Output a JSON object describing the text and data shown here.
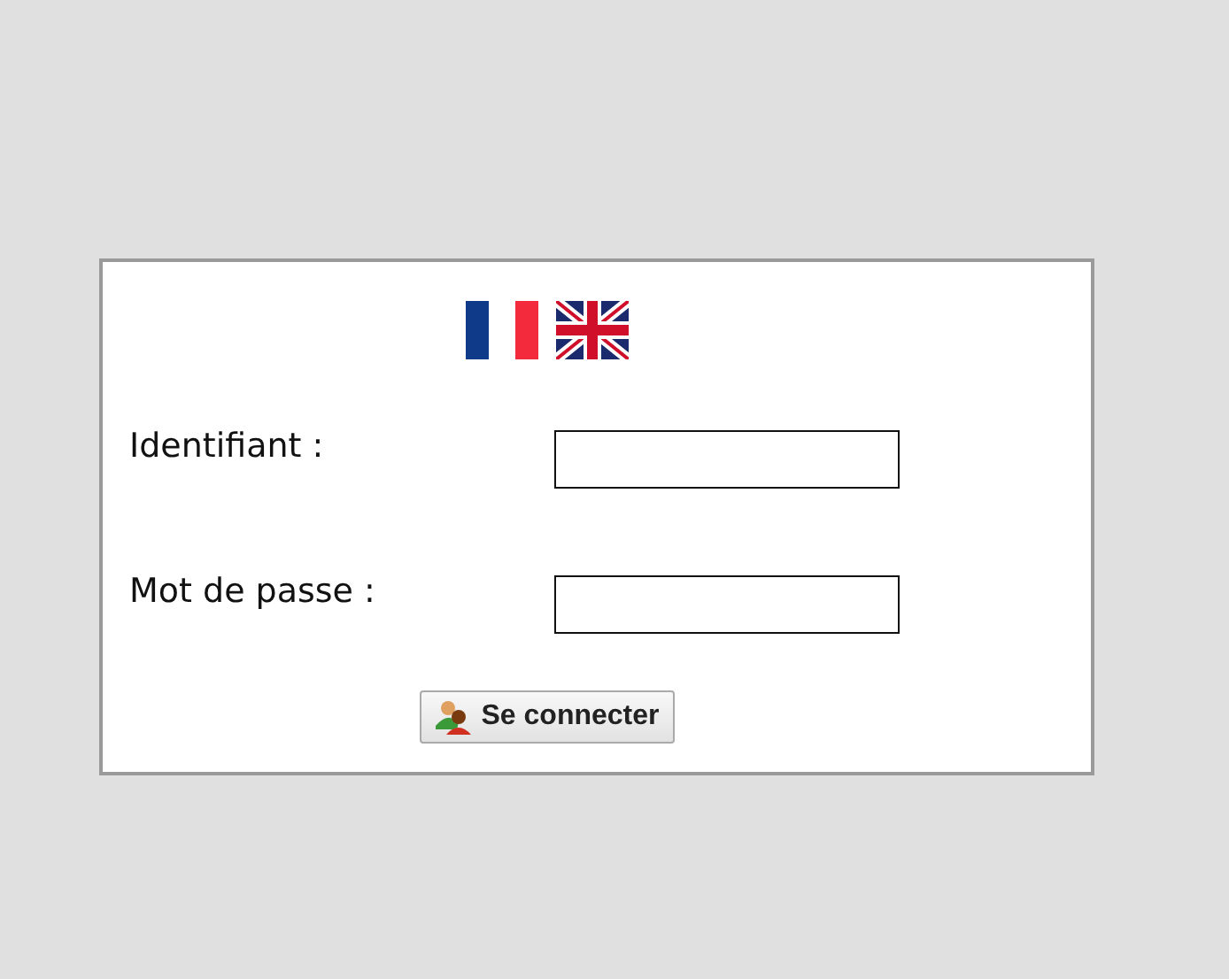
{
  "languages": [
    {
      "kind": "fr"
    },
    {
      "kind": "en"
    }
  ],
  "fields": [
    {
      "label": "Identifiant :"
    },
    {
      "label": "Mot de passe :"
    }
  ],
  "button": {
    "label": "Se connecter"
  }
}
